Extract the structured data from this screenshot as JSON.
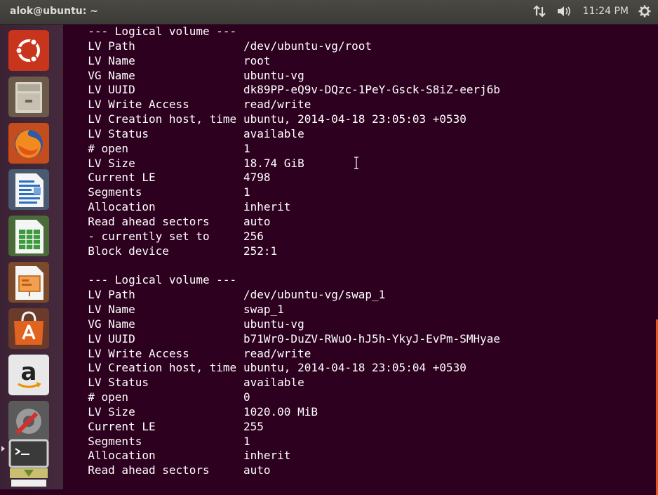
{
  "topbar": {
    "title": "alok@ubuntu: ~",
    "clock": "11:24 PM",
    "icons": [
      "network-arrows-icon",
      "volume-icon",
      "gear-icon"
    ]
  },
  "launcher": {
    "items": [
      "ubuntu-dash",
      "files",
      "firefox",
      "libreoffice-writer",
      "libreoffice-calc",
      "libreoffice-impress",
      "software-center",
      "amazon",
      "system-settings",
      "terminal"
    ]
  },
  "terminal": {
    "lines": [
      {
        "label": "  --- Logical volume ---",
        "value": ""
      },
      {
        "label": "  LV Path",
        "value": "/dev/ubuntu-vg/root"
      },
      {
        "label": "  LV Name",
        "value": "root"
      },
      {
        "label": "  VG Name",
        "value": "ubuntu-vg"
      },
      {
        "label": "  LV UUID",
        "value": "dk89PP-eQ9v-DQzc-1PeY-Gsck-S8iZ-eerj6b"
      },
      {
        "label": "  LV Write Access",
        "value": "read/write"
      },
      {
        "label": "  LV Creation host, time",
        "value": "ubuntu, 2014-04-18 23:05:03 +0530"
      },
      {
        "label": "  LV Status",
        "value": "available"
      },
      {
        "label": "  # open",
        "value": "1"
      },
      {
        "label": "  LV Size",
        "value": "18.74 GiB"
      },
      {
        "label": "  Current LE",
        "value": "4798"
      },
      {
        "label": "  Segments",
        "value": "1"
      },
      {
        "label": "  Allocation",
        "value": "inherit"
      },
      {
        "label": "  Read ahead sectors",
        "value": "auto"
      },
      {
        "label": "  - currently set to",
        "value": "256"
      },
      {
        "label": "  Block device",
        "value": "252:1"
      },
      {
        "label": "",
        "value": ""
      },
      {
        "label": "  --- Logical volume ---",
        "value": ""
      },
      {
        "label": "  LV Path",
        "value": "/dev/ubuntu-vg/swap_1"
      },
      {
        "label": "  LV Name",
        "value": "swap_1"
      },
      {
        "label": "  VG Name",
        "value": "ubuntu-vg"
      },
      {
        "label": "  LV UUID",
        "value": "b71Wr0-DuZV-RWuO-hJ5h-YkyJ-EvPm-SMHyae"
      },
      {
        "label": "  LV Write Access",
        "value": "read/write"
      },
      {
        "label": "  LV Creation host, time",
        "value": "ubuntu, 2014-04-18 23:05:04 +0530"
      },
      {
        "label": "  LV Status",
        "value": "available"
      },
      {
        "label": "  # open",
        "value": "0"
      },
      {
        "label": "  LV Size",
        "value": "1020.00 MiB"
      },
      {
        "label": "  Current LE",
        "value": "255"
      },
      {
        "label": "  Segments",
        "value": "1"
      },
      {
        "label": "  Allocation",
        "value": "inherit"
      },
      {
        "label": "  Read ahead sectors",
        "value": "auto"
      }
    ]
  },
  "colors": {
    "terminal_bg": "#2c001e",
    "panel_bg": "#3c3b37",
    "accent": "#e95420"
  }
}
